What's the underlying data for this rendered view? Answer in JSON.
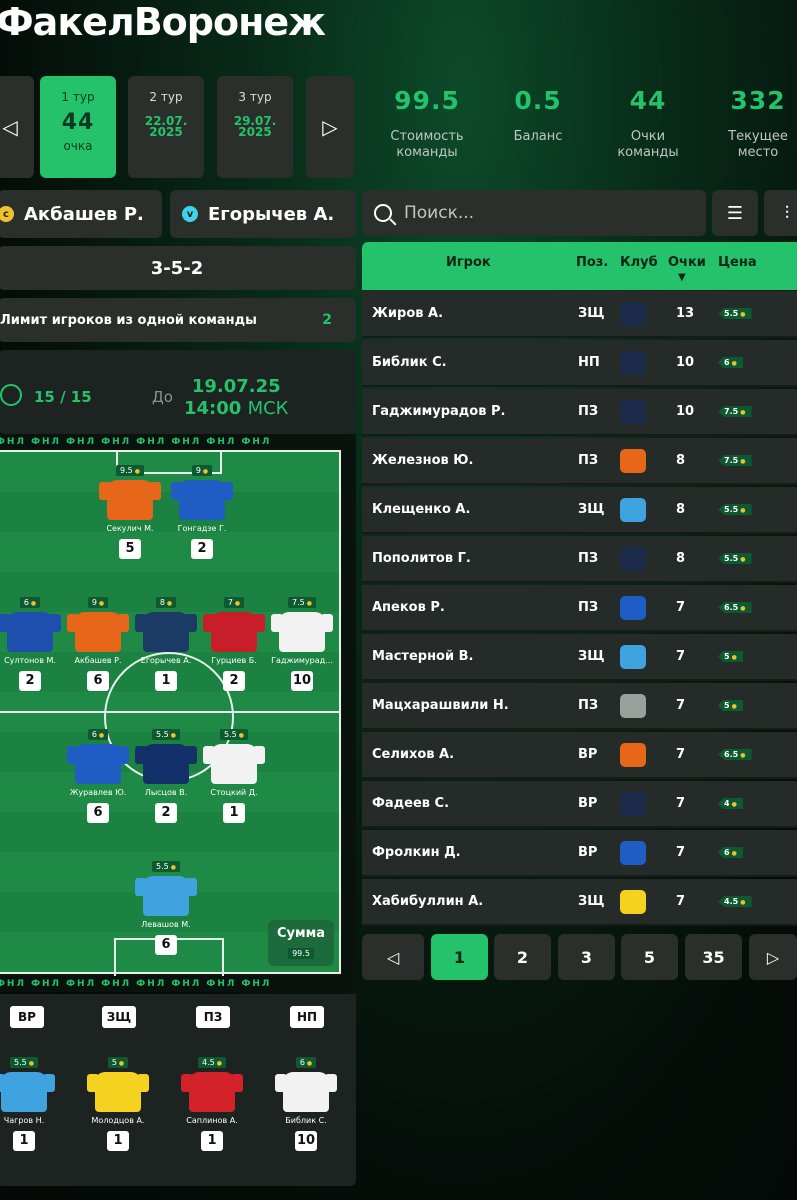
{
  "team_name": "ФакелВоронеж",
  "rounds": {
    "prev_icon": "chevron-left-icon",
    "next_icon": "chevron-right-icon",
    "items": [
      {
        "label": "1 тур",
        "big": "44",
        "sub": "очка",
        "active": true
      },
      {
        "label": "2 тур",
        "date": "22.07. 2025"
      },
      {
        "label": "3 тур",
        "date": "29.07. 2025"
      }
    ]
  },
  "stats": [
    {
      "value": "99.5",
      "label": "Стоимость команды"
    },
    {
      "value": "0.5",
      "label": "Баланс"
    },
    {
      "value": "44",
      "label": "Очки команды"
    },
    {
      "value": "332",
      "label": "Текущее место"
    }
  ],
  "captain": {
    "badge": "c",
    "name": "Акбашев Р."
  },
  "vice_captain": {
    "badge": "v",
    "name": "Егорычев А."
  },
  "formation": "3-5-2",
  "limit": {
    "label": "Лимит игроков из одной команды",
    "value": "2"
  },
  "deadline": {
    "count": "15 / 15",
    "till": "До",
    "date": "19.07.25",
    "time": "14:00",
    "tz": "МСК"
  },
  "ad_text": "ФНЛ ФНЛ ФНЛ ФНЛ ФНЛ ФНЛ ФНЛ ФНЛ",
  "pitch_players": [
    {
      "price": "9.5",
      "name": "Секулич М.",
      "pts": "5",
      "color": "#e8661a"
    },
    {
      "price": "9",
      "name": "Гонгадзе Г.",
      "pts": "2",
      "color": "#1f5cc4"
    },
    {
      "price": "6",
      "name": "Султонов М.",
      "pts": "2",
      "color": "#1e4fae"
    },
    {
      "price": "9",
      "name": "Акбашев Р.",
      "pts": "6",
      "color": "#e8661a"
    },
    {
      "price": "8",
      "name": "Егорычев А.",
      "pts": "1",
      "color": "#1b3a66"
    },
    {
      "price": "7",
      "name": "Гурциев Б.",
      "pts": "2",
      "color": "#c81e2a"
    },
    {
      "price": "7.5",
      "name": "Гаджимурад...",
      "pts": "10",
      "color": "#f2f2f2"
    },
    {
      "price": "6",
      "name": "Журавлев Ю.",
      "pts": "6",
      "color": "#1f5cc4"
    },
    {
      "price": "5.5",
      "name": "Лысцов В.",
      "pts": "2",
      "color": "#14306b"
    },
    {
      "price": "5.5",
      "name": "Стоцкий Д.",
      "pts": "1",
      "color": "#f2f2f2"
    },
    {
      "price": "5.5",
      "name": "Левашов М.",
      "pts": "6",
      "color": "#3fa3e0"
    }
  ],
  "sum": {
    "label": "Сумма",
    "value": "99.5"
  },
  "bench": {
    "tags": [
      "ВР",
      "ЗЩ",
      "ПЗ",
      "НП"
    ],
    "players": [
      {
        "price": "5.5",
        "name": "Чагров Н.",
        "pts": "1",
        "color": "#3fa3e0"
      },
      {
        "price": "5",
        "name": "Молодцов А.",
        "pts": "1",
        "color": "#f4d21f"
      },
      {
        "price": "4.5",
        "name": "Саплинов А.",
        "pts": "1",
        "color": "#d4222a"
      },
      {
        "price": "6",
        "name": "Библик С.",
        "pts": "10",
        "color": "#f2f2f2"
      }
    ]
  },
  "search": {
    "placeholder": "Поиск..."
  },
  "table": {
    "headers": {
      "player": "Игрок",
      "pos": "Поз.",
      "club": "Клуб",
      "pts": "Очки",
      "price": "Цена"
    },
    "rows": [
      {
        "name": "Жиров А.",
        "pos": "ЗЩ",
        "pts": "13",
        "price": "5.5",
        "club_color": "#1d2b4a"
      },
      {
        "name": "Библик С.",
        "pos": "НП",
        "pts": "10",
        "price": "6",
        "club_color": "#1d2b4a"
      },
      {
        "name": "Гаджимурадов Р.",
        "pos": "ПЗ",
        "pts": "10",
        "price": "7.5",
        "club_color": "#1d2b4a"
      },
      {
        "name": "Железнов Ю.",
        "pos": "ПЗ",
        "pts": "8",
        "price": "7.5",
        "club_color": "#e8661a"
      },
      {
        "name": "Клещенко А.",
        "pos": "ЗЩ",
        "pts": "8",
        "price": "5.5",
        "club_color": "#3fa3e0"
      },
      {
        "name": "Пополитов Г.",
        "pos": "ПЗ",
        "pts": "8",
        "price": "5.5",
        "club_color": "#1d2b4a"
      },
      {
        "name": "Апеков Р.",
        "pos": "ПЗ",
        "pts": "7",
        "price": "6.5",
        "club_color": "#1f5cc4"
      },
      {
        "name": "Мастерной В.",
        "pos": "ЗЩ",
        "pts": "7",
        "price": "5",
        "club_color": "#3fa3e0"
      },
      {
        "name": "Мацхарашвили Н.",
        "pos": "ПЗ",
        "pts": "7",
        "price": "5",
        "club_color": "#9aa19d"
      },
      {
        "name": "Селихов А.",
        "pos": "ВР",
        "pts": "7",
        "price": "6.5",
        "club_color": "#e8661a"
      },
      {
        "name": "Фадеев С.",
        "pos": "ВР",
        "pts": "7",
        "price": "4",
        "club_color": "#1d2b4a"
      },
      {
        "name": "Фролкин Д.",
        "pos": "ВР",
        "pts": "7",
        "price": "6",
        "club_color": "#1f5cc4"
      },
      {
        "name": "Хабибуллин А.",
        "pos": "ЗЩ",
        "pts": "7",
        "price": "4.5",
        "club_color": "#f4d21f"
      }
    ]
  },
  "pagination": [
    "1",
    "2",
    "3",
    "5",
    "35"
  ],
  "colors": {
    "accent": "#23c26b",
    "panel": "#2a2f2c"
  }
}
